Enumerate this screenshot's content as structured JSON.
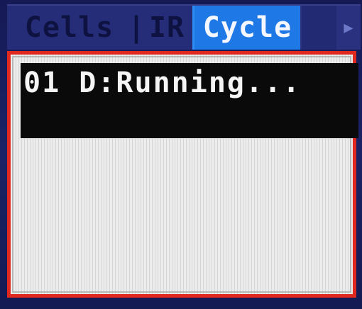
{
  "tabs": [
    {
      "label": "Cells",
      "active": false
    },
    {
      "label": "IR",
      "active": false
    },
    {
      "label": "Cycle",
      "active": true
    }
  ],
  "tab_separator": "|",
  "nav_arrow_icon": "arrow-right-icon",
  "status": {
    "line": "01 D:Running..."
  },
  "colors": {
    "active_tab": "#1e78e6",
    "frame_border": "#e0281f",
    "status_bg": "#0a0a0a"
  }
}
